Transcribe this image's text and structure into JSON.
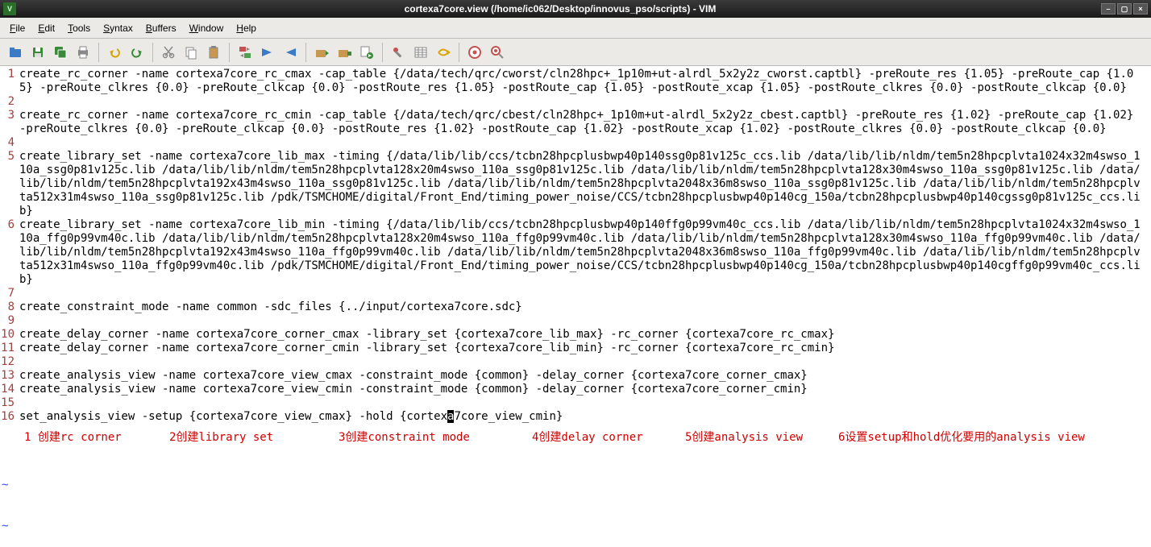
{
  "window": {
    "title": "cortexa7core.view (/home/ic062/Desktop/innovus_pso/scripts) - VIM"
  },
  "menu": {
    "file": "File",
    "edit": "Edit",
    "tools": "Tools",
    "syntax": "Syntax",
    "buffers": "Buffers",
    "window": "Window",
    "help": "Help"
  },
  "toolbar_icons": {
    "open": "open",
    "save": "save",
    "saveall": "saveall",
    "print": "print",
    "undo": "undo",
    "redo": "redo",
    "cut": "cut",
    "copy": "copy",
    "paste": "paste",
    "find": "find",
    "findnext": "findnext",
    "findprev": "findprev",
    "session_new": "session-new",
    "session_save": "session-save",
    "session_load": "session-load",
    "make": "make",
    "shell": "shell",
    "ctags": "ctags",
    "help": "help",
    "findhelp": "findhelp"
  },
  "code": {
    "lines": [
      {
        "n": 1,
        "t": "create_rc_corner -name cortexa7core_rc_cmax -cap_table {/data/tech/qrc/cworst/cln28hpc+_1p10m+ut-alrdl_5x2y2z_cworst.captbl} -preRoute_res {1.05} -preRoute_cap {1.05} -preRoute_clkres {0.0} -preRoute_clkcap {0.0} -postRoute_res {1.05} -postRoute_cap {1.05} -postRoute_xcap {1.05} -postRoute_clkres {0.0} -postRoute_clkcap {0.0}"
      },
      {
        "n": 2,
        "t": ""
      },
      {
        "n": 3,
        "t": "create_rc_corner -name cortexa7core_rc_cmin -cap_table {/data/tech/qrc/cbest/cln28hpc+_1p10m+ut-alrdl_5x2y2z_cbest.captbl} -preRoute_res {1.02} -preRoute_cap {1.02} -preRoute_clkres {0.0} -preRoute_clkcap {0.0} -postRoute_res {1.02} -postRoute_cap {1.02} -postRoute_xcap {1.02} -postRoute_clkres {0.0} -postRoute_clkcap {0.0}"
      },
      {
        "n": 4,
        "t": ""
      },
      {
        "n": 5,
        "t": "create_library_set -name cortexa7core_lib_max -timing {/data/lib/lib/ccs/tcbn28hpcplusbwp40p140ssg0p81v125c_ccs.lib /data/lib/lib/nldm/tem5n28hpcplvta1024x32m4swso_110a_ssg0p81v125c.lib /data/lib/lib/nldm/tem5n28hpcplvta128x20m4swso_110a_ssg0p81v125c.lib /data/lib/lib/nldm/tem5n28hpcplvta128x30m4swso_110a_ssg0p81v125c.lib /data/lib/lib/nldm/tem5n28hpcplvta192x43m4swso_110a_ssg0p81v125c.lib /data/lib/lib/nldm/tem5n28hpcplvta2048x36m8swso_110a_ssg0p81v125c.lib /data/lib/lib/nldm/tem5n28hpcplvta512x31m4swso_110a_ssg0p81v125c.lib /pdk/TSMCHOME/digital/Front_End/timing_power_noise/CCS/tcbn28hpcplusbwp40p140cg_150a/tcbn28hpcplusbwp40p140cgssg0p81v125c_ccs.lib}"
      },
      {
        "n": 6,
        "t": "create_library_set -name cortexa7core_lib_min -timing {/data/lib/lib/ccs/tcbn28hpcplusbwp40p140ffg0p99vm40c_ccs.lib /data/lib/lib/nldm/tem5n28hpcplvta1024x32m4swso_110a_ffg0p99vm40c.lib /data/lib/lib/nldm/tem5n28hpcplvta128x20m4swso_110a_ffg0p99vm40c.lib /data/lib/lib/nldm/tem5n28hpcplvta128x30m4swso_110a_ffg0p99vm40c.lib /data/lib/lib/nldm/tem5n28hpcplvta192x43m4swso_110a_ffg0p99vm40c.lib /data/lib/lib/nldm/tem5n28hpcplvta2048x36m8swso_110a_ffg0p99vm40c.lib /data/lib/lib/nldm/tem5n28hpcplvta512x31m4swso_110a_ffg0p99vm40c.lib /pdk/TSMCHOME/digital/Front_End/timing_power_noise/CCS/tcbn28hpcplusbwp40p140cg_150a/tcbn28hpcplusbwp40p140cgffg0p99vm40c_ccs.lib}"
      },
      {
        "n": 7,
        "t": ""
      },
      {
        "n": 8,
        "t": "create_constraint_mode -name common -sdc_files {../input/cortexa7core.sdc}"
      },
      {
        "n": 9,
        "t": ""
      },
      {
        "n": 10,
        "t": "create_delay_corner -name cortexa7core_corner_cmax -library_set {cortexa7core_lib_max} -rc_corner {cortexa7core_rc_cmax}"
      },
      {
        "n": 11,
        "t": "create_delay_corner -name cortexa7core_corner_cmin -library_set {cortexa7core_lib_min} -rc_corner {cortexa7core_rc_cmin}"
      },
      {
        "n": 12,
        "t": ""
      },
      {
        "n": 13,
        "t": "create_analysis_view -name cortexa7core_view_cmax -constraint_mode {common} -delay_corner {cortexa7core_corner_cmax}"
      },
      {
        "n": 14,
        "t": "create_analysis_view -name cortexa7core_view_cmin -constraint_mode {common} -delay_corner {cortexa7core_corner_cmin}"
      },
      {
        "n": 15,
        "t": ""
      },
      {
        "n": 16,
        "t": "set_analysis_view -setup {cortexa7core_view_cmax} -hold {cortexa7core_view_cmin}"
      }
    ],
    "cursor": {
      "line": 16,
      "pre": "set_analysis_view -setup {cortexa7core_view_cmax} -hold {cortex",
      "ch": "a",
      "post": "7core_view_cmin}"
    }
  },
  "annotations": {
    "a1": "1 创建rc corner",
    "a2": "2创建library set",
    "a3": "3创建constraint mode",
    "a4": "4创建delay corner",
    "a5": "5创建analysis view",
    "a6": "6设置setup和hold优化要用的analysis view"
  }
}
